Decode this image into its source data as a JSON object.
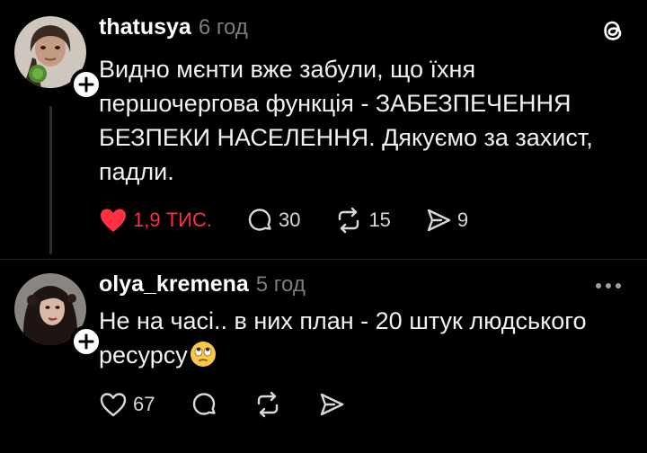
{
  "posts": [
    {
      "username": "thatusya",
      "time": "6 год",
      "text": "Видно мєнти вже забули, що їхня першочергова функція - ЗАБЕЗПЕЧЕННЯ БЕЗПЕКИ НАСЕЛЕННЯ. Дякуємо за захист, падли.",
      "likes": "1,9 ТИС.",
      "liked": true,
      "comments": "30",
      "reposts": "15",
      "shares": "9"
    },
    {
      "username": "olya_kremena",
      "time": "5 год",
      "text": "Не на часі.. в них план - 20 штук людського ресурсу",
      "likes": "67",
      "liked": false
    }
  ],
  "colors": {
    "background": "#000000",
    "like_red": "#ff3040",
    "muted": "#7d7d7d"
  },
  "icons": [
    "threads-logo-icon",
    "plus-icon",
    "heart-icon",
    "comment-icon",
    "repost-icon",
    "share-icon",
    "more-icon",
    "eye-roll-emoji"
  ]
}
